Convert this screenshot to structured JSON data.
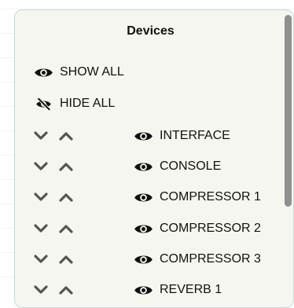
{
  "panel": {
    "title": "Devices",
    "show_all_label": "SHOW ALL",
    "hide_all_label": "HIDE ALL",
    "devices": [
      {
        "label": "INTERFACE"
      },
      {
        "label": "CONSOLE"
      },
      {
        "label": "COMPRESSOR 1"
      },
      {
        "label": "COMPRESSOR 2"
      },
      {
        "label": "COMPRESSOR 3"
      },
      {
        "label": "REVERB 1"
      }
    ]
  },
  "icons": {
    "show_all": "eye-icon",
    "hide_all": "eye-slash-icon",
    "move_down": "chevron-down-icon",
    "move_up": "chevron-up-icon",
    "visibility": "eye-icon"
  },
  "colors": {
    "panel_bg": "#f6f6f0",
    "panel_border": "#c9d9d7",
    "icon_dark": "#111111",
    "chevron_gray": "#555555",
    "scrollbar": "#8f8f8f"
  }
}
